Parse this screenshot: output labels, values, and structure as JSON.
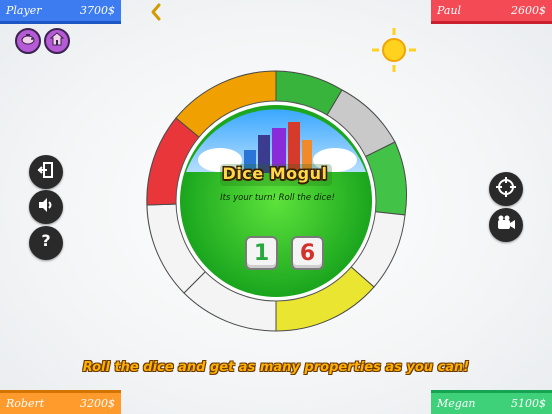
{
  "players": {
    "top_left": {
      "name": "Player",
      "money": "3700$",
      "color": "#3d7cf0"
    },
    "top_right": {
      "name": "Paul",
      "money": "2600$",
      "color": "#f34a55"
    },
    "bottom_left": {
      "name": "Robert",
      "money": "3200$",
      "color": "#ff9a2c"
    },
    "bottom_right": {
      "name": "Megan",
      "money": "5100$",
      "color": "#3fd07a"
    }
  },
  "game": {
    "title": "Dice Mogul",
    "turn_message": "Its your turn! Roll the dice!",
    "dice": [
      "1",
      "6"
    ],
    "hint": "Roll the dice and get as many properties as you can!"
  },
  "icons": {
    "top": [
      "back-chevron-icon",
      "piggy-bank-icon",
      "house-icon"
    ],
    "left": [
      "exit-icon",
      "speaker-icon",
      "help-icon"
    ],
    "right": [
      "target-icon",
      "camera-icon"
    ]
  }
}
